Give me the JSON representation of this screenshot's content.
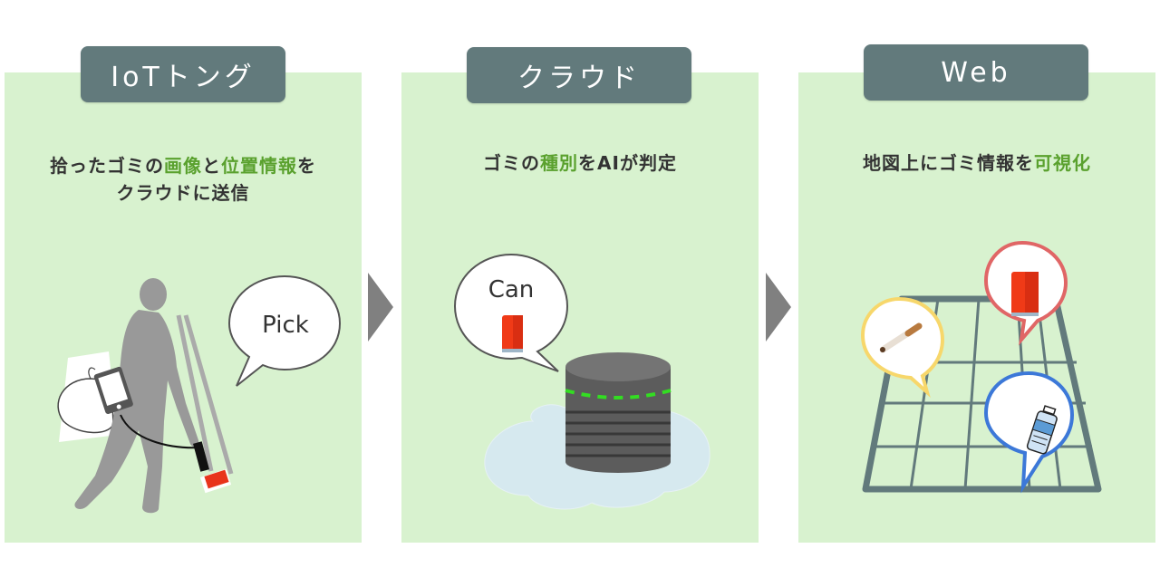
{
  "panels": [
    {
      "title": "IoTトング",
      "description": {
        "line1_parts": [
          "拾ったゴミの",
          "画像",
          "と",
          "位置情報",
          "を"
        ],
        "line2": "クラウドに送信"
      },
      "bubble_text": "Pick",
      "illustration": "person-with-iot-tongs"
    },
    {
      "title": "クラウド",
      "description": {
        "parts": [
          "ゴミの",
          "種別",
          "をAIが判定"
        ]
      },
      "bubble_text": "Can",
      "illustration": "cloud-database"
    },
    {
      "title": "Web",
      "description": {
        "parts": [
          "地図上にゴミ情報を",
          "可視化"
        ]
      },
      "illustration": "map-with-trash-pins",
      "pins": [
        {
          "item": "cigarette",
          "color": "#f7d76b"
        },
        {
          "item": "can",
          "color": "#e06666"
        },
        {
          "item": "plastic-bottle",
          "color": "#3c78d8"
        }
      ]
    }
  ],
  "colors": {
    "panel_bg": "#d8f2cf",
    "tab_bg": "#627a7c",
    "highlight": "#5aa12e",
    "arrow": "#808080"
  },
  "flow_arrows": [
    "arrow-right",
    "arrow-right"
  ]
}
